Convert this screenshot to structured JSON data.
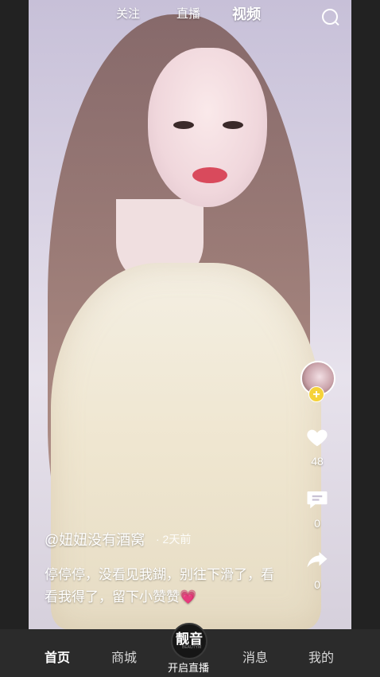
{
  "top_tabs": {
    "following": "关注",
    "live": "直播",
    "video": "视频",
    "search_icon": "search-icon"
  },
  "video": {
    "author": "@妞妞没有酒窝",
    "time_ago": "· 2天前",
    "description": "停停停，没看见我鍸，别往下滑了，看看我得了，留下小赞赞",
    "description_emoji": "💗"
  },
  "actions": {
    "like_count": "48",
    "comment_count": "0",
    "share_count": "0",
    "follow_plus": "+"
  },
  "bottom_nav": {
    "home": "首页",
    "mall": "商城",
    "logo_text": "靓音",
    "logo_sub": "BEAUTYM",
    "live_start": "开启直播",
    "messages": "消息",
    "me": "我的"
  },
  "colors": {
    "accent_yellow": "#f5d23a",
    "nav_bg": "#2b2b2b",
    "heart_pink": "#ff5fa2"
  }
}
